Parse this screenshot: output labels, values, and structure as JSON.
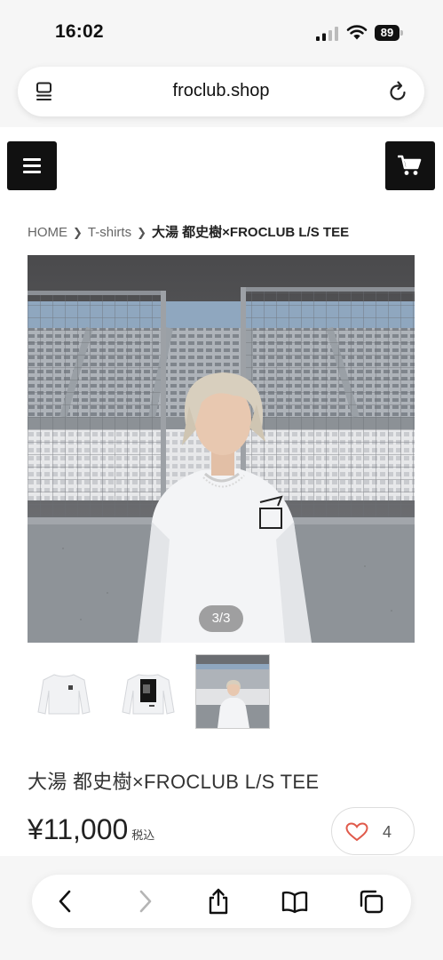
{
  "status": {
    "time": "16:02",
    "battery": "89"
  },
  "browser": {
    "url": "froclub.shop",
    "icons": {
      "tabs": "tab-overview-icon",
      "reload": "reload-icon",
      "back": "back-chevron-icon",
      "forward": "forward-chevron-icon",
      "share": "share-icon",
      "bookmarks": "book-icon",
      "tabs_bottom": "tabs-icon"
    }
  },
  "header": {
    "menu_icon": "hamburger-menu-icon",
    "cart_icon": "shopping-cart-icon"
  },
  "breadcrumb": {
    "home": "HOME",
    "category": "T-shirts",
    "current": "大湯 都史樹×FROCLUB L/S TEE"
  },
  "gallery": {
    "counter": "3/3",
    "current_index": 3,
    "total": 3,
    "thumbnails": [
      "white-longsleeve-front",
      "white-longsleeve-back",
      "model-photo-stadium"
    ]
  },
  "product": {
    "title": "大湯 都史樹×FROCLUB L/S TEE",
    "price": "¥11,000",
    "tax_label": "税込",
    "like_count": "4"
  },
  "colors": {
    "button_dark": "#111111",
    "heart": "#e05a4b",
    "forward_disabled": "#b5b5b5"
  }
}
